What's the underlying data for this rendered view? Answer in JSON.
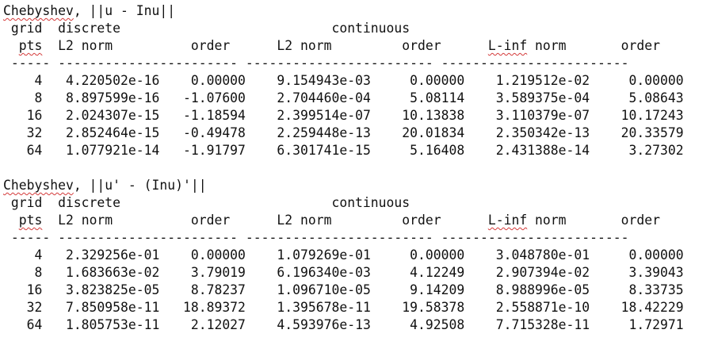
{
  "sections": [
    {
      "title_word": "Chebyshev",
      "title_rest": ", ||u - Inu||",
      "header1": " grid  discrete                           continuous",
      "header2_lead": "  ",
      "header2_pts": "pts",
      "header2_mid": "  L2 norm          order      L2 norm         order      ",
      "header2_linf": "L-inf",
      "header2_tail": " norm       order",
      "separator": " ----- ----------------------- ------------------------ ------------------------",
      "rows": [
        [
          "4",
          "4.220502e-16",
          "0.00000",
          "9.154943e-03",
          "0.00000",
          "1.219512e-02",
          "0.00000"
        ],
        [
          "8",
          "8.897599e-16",
          "-1.07600",
          "2.704460e-04",
          "5.08114",
          "3.589375e-04",
          "5.08643"
        ],
        [
          "16",
          "2.024307e-15",
          "-1.18594",
          "2.399514e-07",
          "10.13838",
          "3.110379e-07",
          "10.17243"
        ],
        [
          "32",
          "2.852464e-15",
          "-0.49478",
          "2.259448e-13",
          "20.01834",
          "2.350342e-13",
          "20.33579"
        ],
        [
          "64",
          "1.077921e-14",
          "-1.91797",
          "6.301741e-15",
          "5.16408",
          "2.431388e-14",
          "3.27302"
        ]
      ]
    },
    {
      "title_word": "Chebyshev",
      "title_rest": ", ||u' - (Inu)'||",
      "header1": " grid  discrete                           continuous",
      "header2_lead": "  ",
      "header2_pts": "pts",
      "header2_mid": "  L2 norm          order      L2 norm         order      ",
      "header2_linf": "L-inf",
      "header2_tail": " norm       order",
      "separator": " ----- ----------------------- ------------------------ ------------------------",
      "rows": [
        [
          "4",
          "2.329256e-01",
          "0.00000",
          "1.079269e-01",
          "0.00000",
          "3.048780e-01",
          "0.00000"
        ],
        [
          "8",
          "1.683663e-02",
          "3.79019",
          "6.196340e-03",
          "4.12249",
          "2.907394e-02",
          "3.39043"
        ],
        [
          "16",
          "3.823825e-05",
          "8.78237",
          "1.096710e-05",
          "9.14209",
          "8.988996e-05",
          "8.33735"
        ],
        [
          "32",
          "7.850958e-11",
          "18.89372",
          "1.395678e-11",
          "19.58378",
          "2.558871e-10",
          "18.42229"
        ],
        [
          "64",
          "1.805753e-11",
          "2.12027",
          "4.593976e-13",
          "4.92508",
          "7.715328e-11",
          "1.72971"
        ]
      ]
    }
  ]
}
